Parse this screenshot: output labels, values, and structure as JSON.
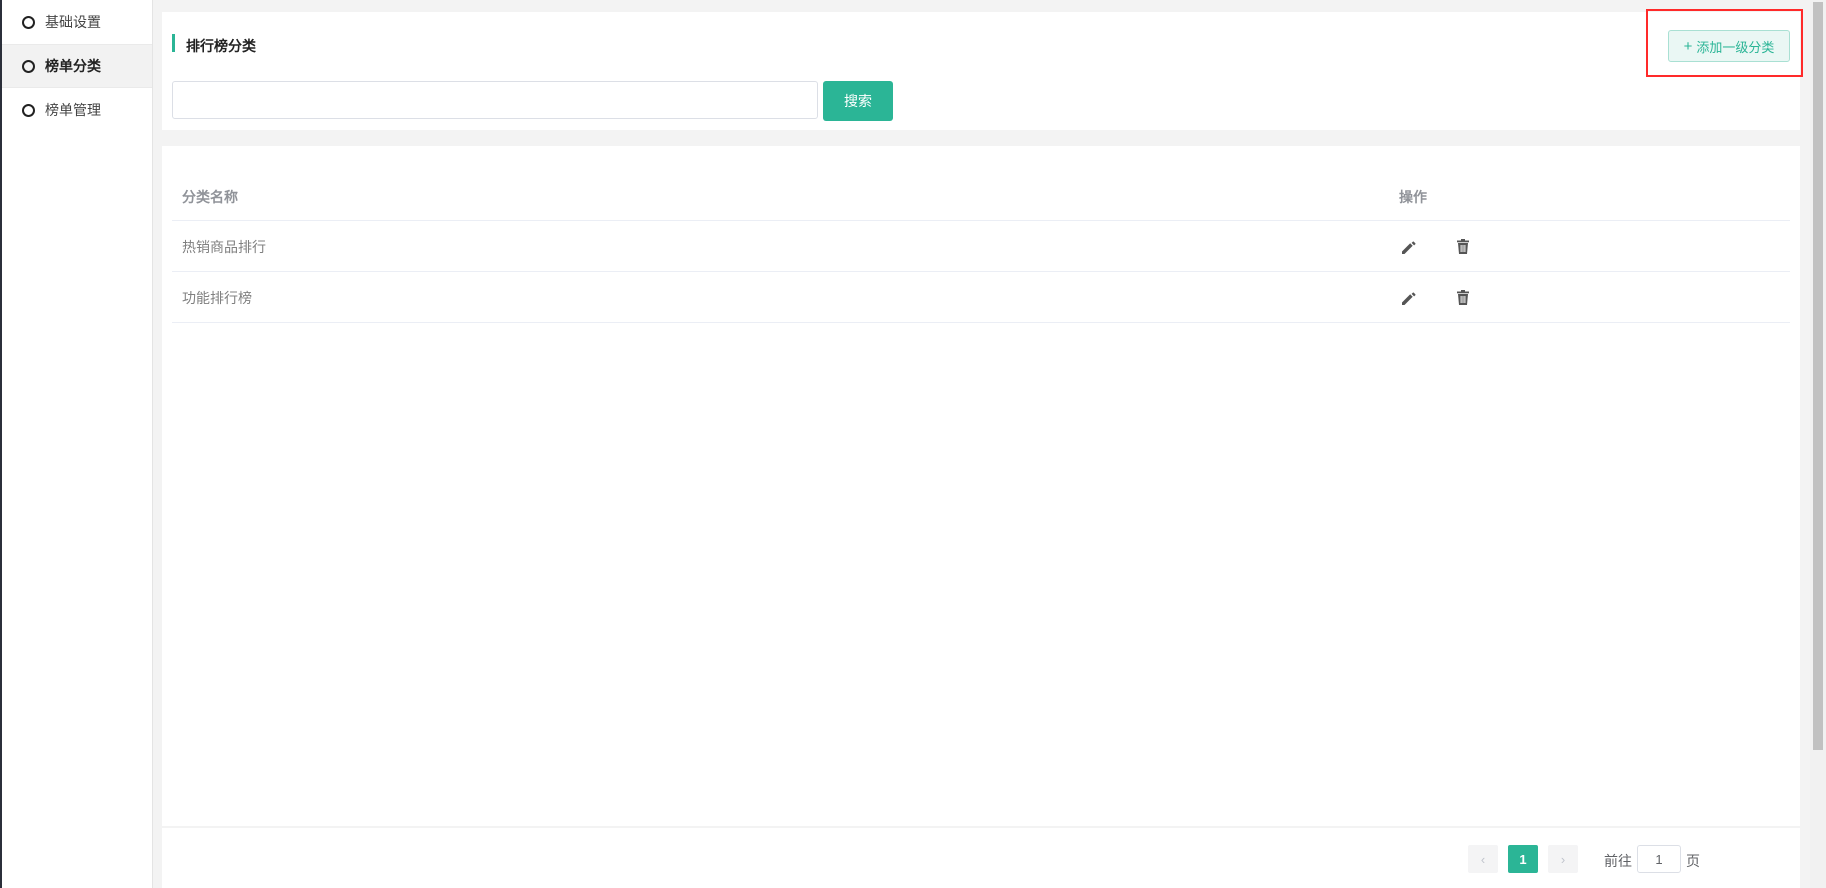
{
  "sidebar": {
    "items": [
      {
        "label": "基础设置",
        "active": false
      },
      {
        "label": "榜单分类",
        "active": true
      },
      {
        "label": "榜单管理",
        "active": false
      }
    ]
  },
  "header": {
    "title": "排行榜分类",
    "add_button_label": "添加一级分类",
    "add_button_icon": "plus-icon"
  },
  "search": {
    "value": "",
    "placeholder": "",
    "button_label": "搜索"
  },
  "table": {
    "columns": [
      "分类名称",
      "操作"
    ],
    "rows": [
      {
        "name": "热销商品排行"
      },
      {
        "name": "功能排行榜"
      }
    ],
    "row_actions": [
      "edit-icon",
      "delete-icon"
    ]
  },
  "pagination": {
    "current_page": "1",
    "goto_label": "前往",
    "goto_value": "1",
    "page_suffix": "页"
  },
  "colors": {
    "accent": "#2bb596",
    "highlight": "#ff2a2a"
  }
}
